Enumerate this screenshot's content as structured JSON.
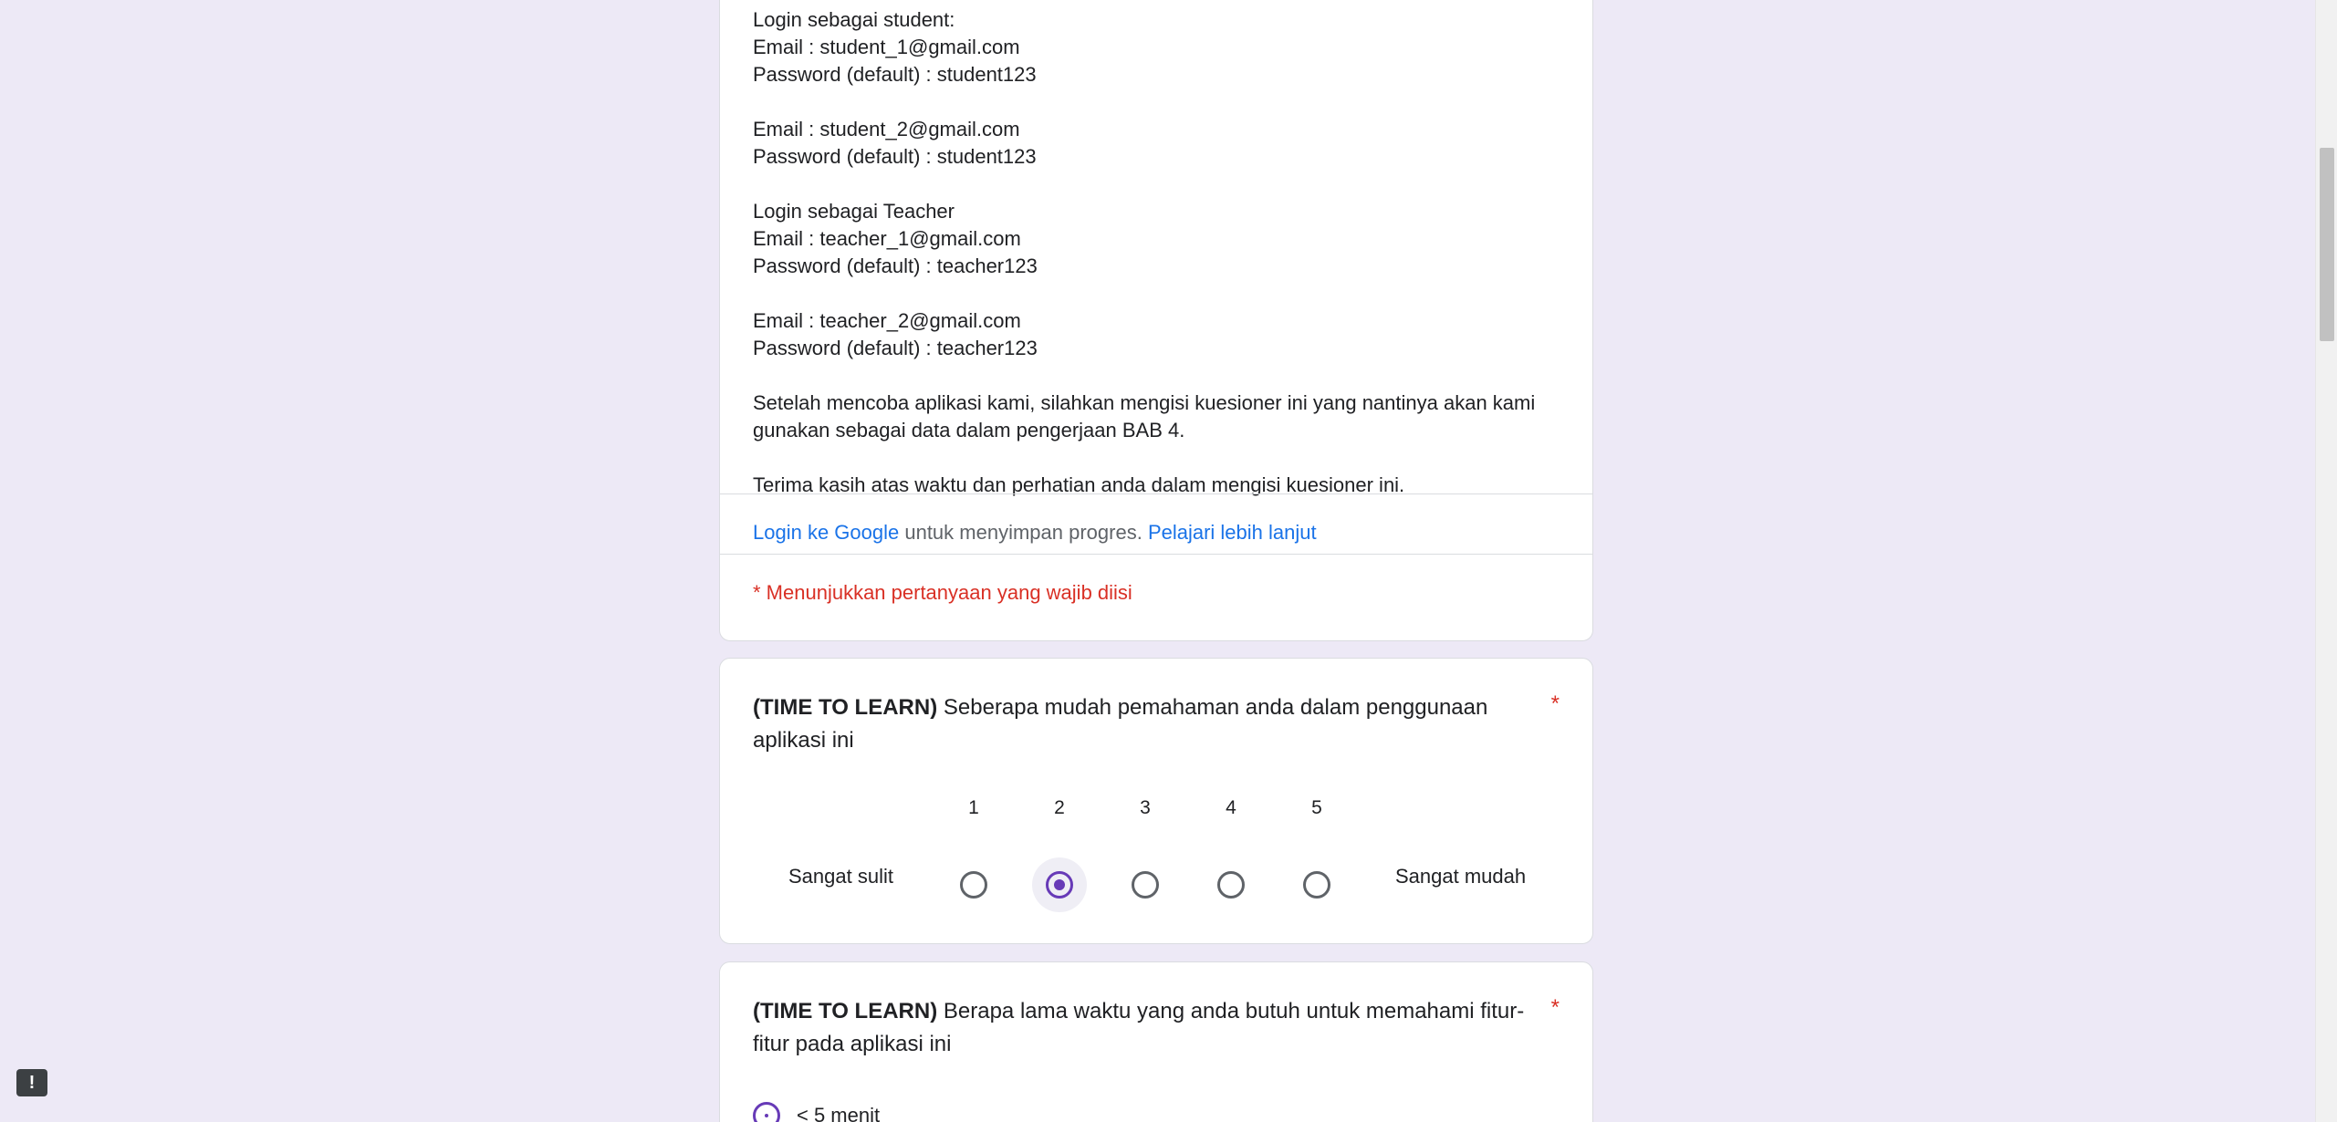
{
  "description": "Login sebagai student:\nEmail : student_1@gmail.com\nPassword (default) : student123\n\nEmail : student_2@gmail.com\nPassword (default) : student123\n\nLogin sebagai Teacher\nEmail : teacher_1@gmail.com\nPassword (default) : teacher123\n\nEmail : teacher_2@gmail.com\nPassword (default) : teacher123\n\nSetelah mencoba aplikasi kami, silahkan mengisi kuesioner ini yang nantinya akan kami gunakan sebagai data dalam pengerjaan BAB 4.\n\nTerima kasih atas waktu dan perhatian anda dalam mengisi kuesioner ini.",
  "login_bar": {
    "login_link": "Login ke Google",
    "middle_text": " untuk menyimpan progres. ",
    "learn_more_link": "Pelajari lebih lanjut"
  },
  "required_note": "* Menunjukkan pertanyaan yang wajib diisi",
  "question1": {
    "tag": "(TIME TO LEARN)",
    "text": " Seberapa mudah pemahaman anda dalam penggunaan aplikasi ini",
    "required_mark": "*",
    "scale": [
      "1",
      "2",
      "3",
      "4",
      "5"
    ],
    "selected": "2",
    "low_label": "Sangat sulit",
    "high_label": "Sangat mudah"
  },
  "question2": {
    "tag": "(TIME TO LEARN)",
    "text": " Berapa lama waktu yang anda butuh untuk memahami fitur-fitur pada aplikasi ini",
    "required_mark": "*",
    "option1": "< 5 menit"
  },
  "feedback_icon_label": "!",
  "colors": {
    "background": "#ede9f6",
    "accent": "#673ab7",
    "link": "#1a73e8",
    "required": "#d93025"
  }
}
